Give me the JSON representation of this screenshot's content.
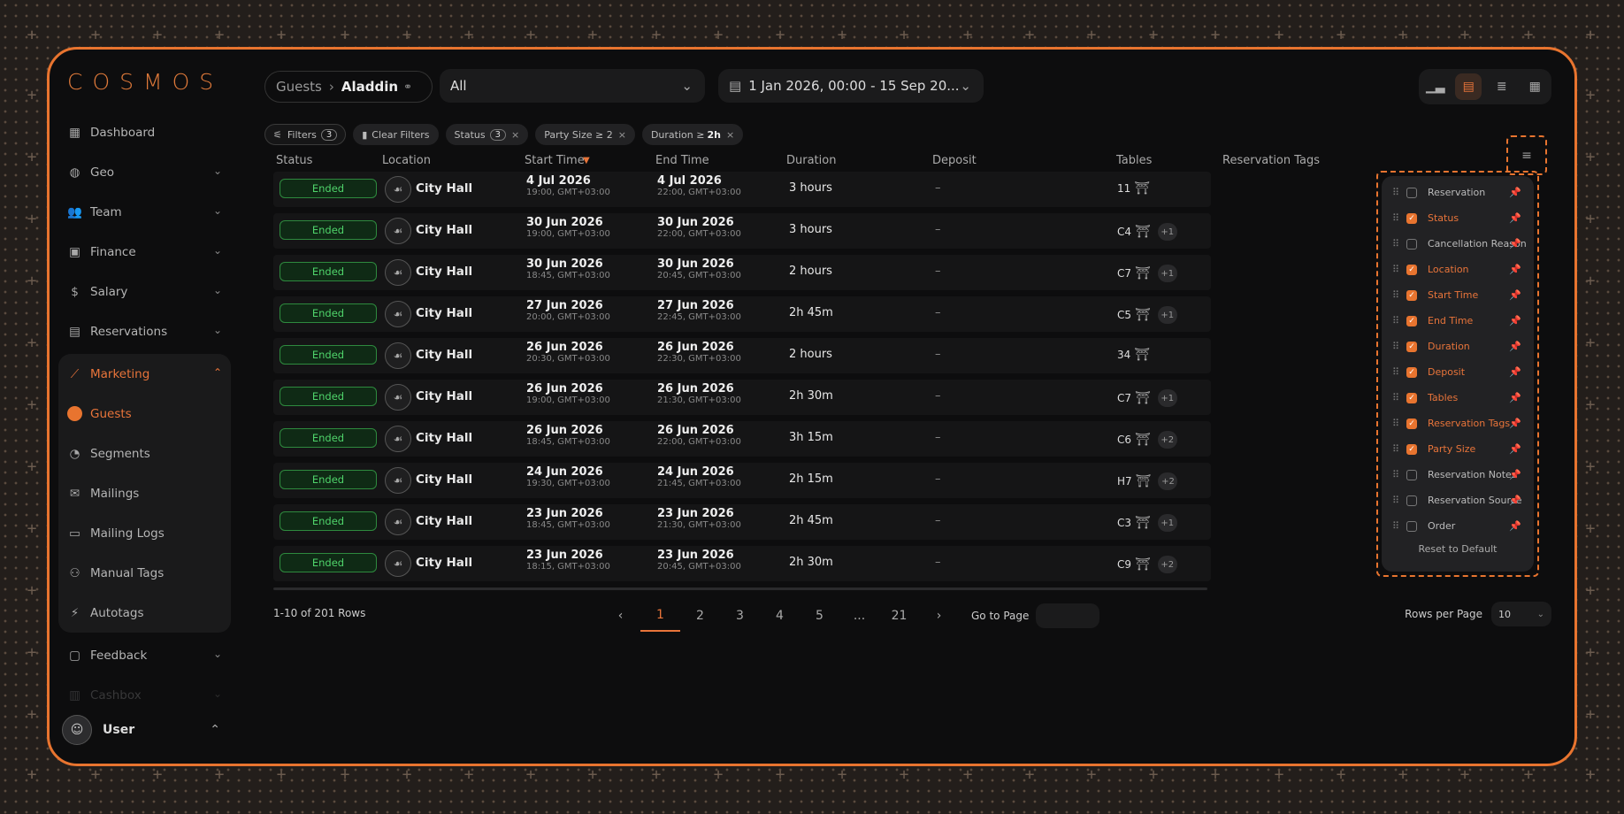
{
  "app": {
    "logo": "COSMOS"
  },
  "sidebar": {
    "items": [
      {
        "label": "Dashboard"
      },
      {
        "label": "Geo"
      },
      {
        "label": "Team"
      },
      {
        "label": "Finance"
      },
      {
        "label": "Salary"
      },
      {
        "label": "Reservations"
      },
      {
        "label": "Marketing"
      },
      {
        "label": "Guests"
      },
      {
        "label": "Segments"
      },
      {
        "label": "Mailings"
      },
      {
        "label": "Mailing Logs"
      },
      {
        "label": "Manual Tags"
      },
      {
        "label": "Autotags"
      },
      {
        "label": "Feedback"
      },
      {
        "label": "Cashbox"
      }
    ],
    "user": "User"
  },
  "header": {
    "crumb_parent": "Guests",
    "crumb_current": "Aladdin",
    "select_value": "All",
    "date_range": "1 Jan 2026, 00:00 - 15 Sep 20..."
  },
  "chips": {
    "filters": "Filters",
    "filters_count": "3",
    "clear": "Clear Filters",
    "status": "Status",
    "status_count": "3",
    "party": "Party Size ≥ 2",
    "duration_label": "Duration ≥ ",
    "duration_value": "2h"
  },
  "table": {
    "headers": [
      "Status",
      "Location",
      "Start Time",
      "End Time",
      "Duration",
      "Deposit",
      "Tables",
      "Reservation Tags"
    ],
    "rows": [
      {
        "status": "Ended",
        "location": "City Hall",
        "sd": "4 Jul 2026",
        "st": "19:00, GMT+03:00",
        "ed": "4 Jul 2026",
        "et": "22:00, GMT+03:00",
        "dur": "3 hours",
        "dep": "–",
        "tbl": "11",
        "more": ""
      },
      {
        "status": "Ended",
        "location": "City Hall",
        "sd": "30 Jun 2026",
        "st": "19:00, GMT+03:00",
        "ed": "30 Jun 2026",
        "et": "22:00, GMT+03:00",
        "dur": "3 hours",
        "dep": "–",
        "tbl": "C4",
        "more": "+1"
      },
      {
        "status": "Ended",
        "location": "City Hall",
        "sd": "30 Jun 2026",
        "st": "18:45, GMT+03:00",
        "ed": "30 Jun 2026",
        "et": "20:45, GMT+03:00",
        "dur": "2 hours",
        "dep": "–",
        "tbl": "C7",
        "more": "+1"
      },
      {
        "status": "Ended",
        "location": "City Hall",
        "sd": "27 Jun 2026",
        "st": "20:00, GMT+03:00",
        "ed": "27 Jun 2026",
        "et": "22:45, GMT+03:00",
        "dur": "2h 45m",
        "dep": "–",
        "tbl": "C5",
        "more": "+1"
      },
      {
        "status": "Ended",
        "location": "City Hall",
        "sd": "26 Jun 2026",
        "st": "20:30, GMT+03:00",
        "ed": "26 Jun 2026",
        "et": "22:30, GMT+03:00",
        "dur": "2 hours",
        "dep": "–",
        "tbl": "34",
        "more": ""
      },
      {
        "status": "Ended",
        "location": "City Hall",
        "sd": "26 Jun 2026",
        "st": "19:00, GMT+03:00",
        "ed": "26 Jun 2026",
        "et": "21:30, GMT+03:00",
        "dur": "2h 30m",
        "dep": "–",
        "tbl": "C7",
        "more": "+1"
      },
      {
        "status": "Ended",
        "location": "City Hall",
        "sd": "26 Jun 2026",
        "st": "18:45, GMT+03:00",
        "ed": "26 Jun 2026",
        "et": "22:00, GMT+03:00",
        "dur": "3h 15m",
        "dep": "–",
        "tbl": "C6",
        "more": "+2"
      },
      {
        "status": "Ended",
        "location": "City Hall",
        "sd": "24 Jun 2026",
        "st": "19:30, GMT+03:00",
        "ed": "24 Jun 2026",
        "et": "21:45, GMT+03:00",
        "dur": "2h 15m",
        "dep": "–",
        "tbl": "H7",
        "more": "+2"
      },
      {
        "status": "Ended",
        "location": "City Hall",
        "sd": "23 Jun 2026",
        "st": "18:45, GMT+03:00",
        "ed": "23 Jun 2026",
        "et": "21:30, GMT+03:00",
        "dur": "2h 45m",
        "dep": "–",
        "tbl": "C3",
        "more": "+1"
      },
      {
        "status": "Ended",
        "location": "City Hall",
        "sd": "23 Jun 2026",
        "st": "18:15, GMT+03:00",
        "ed": "23 Jun 2026",
        "et": "20:45, GMT+03:00",
        "dur": "2h 30m",
        "dep": "–",
        "tbl": "C9",
        "more": "+2"
      }
    ]
  },
  "columns_panel": {
    "items": [
      {
        "label": "Reservation",
        "checked": false
      },
      {
        "label": "Status",
        "checked": true
      },
      {
        "label": "Cancellation Reason",
        "checked": false
      },
      {
        "label": "Location",
        "checked": true
      },
      {
        "label": "Start Time",
        "checked": true
      },
      {
        "label": "End Time",
        "checked": true
      },
      {
        "label": "Duration",
        "checked": true
      },
      {
        "label": "Deposit",
        "checked": true
      },
      {
        "label": "Tables",
        "checked": true
      },
      {
        "label": "Reservation Tags",
        "checked": true
      },
      {
        "label": "Party Size",
        "checked": true
      },
      {
        "label": "Reservation Notes",
        "checked": false
      },
      {
        "label": "Reservation Source",
        "checked": false
      },
      {
        "label": "Order",
        "checked": false
      }
    ],
    "reset": "Reset to Default"
  },
  "footer": {
    "rows_info": "1-10  of  201 Rows",
    "pages": [
      "1",
      "2",
      "3",
      "4",
      "5",
      "...",
      "21"
    ],
    "goto": "Go to Page",
    "rpp_label": "Rows per Page",
    "rpp_value": "10"
  },
  "colors": {
    "accent": "#e8742f",
    "ended_text": "#4fd36a",
    "ended_border": "#2e8a3e"
  }
}
